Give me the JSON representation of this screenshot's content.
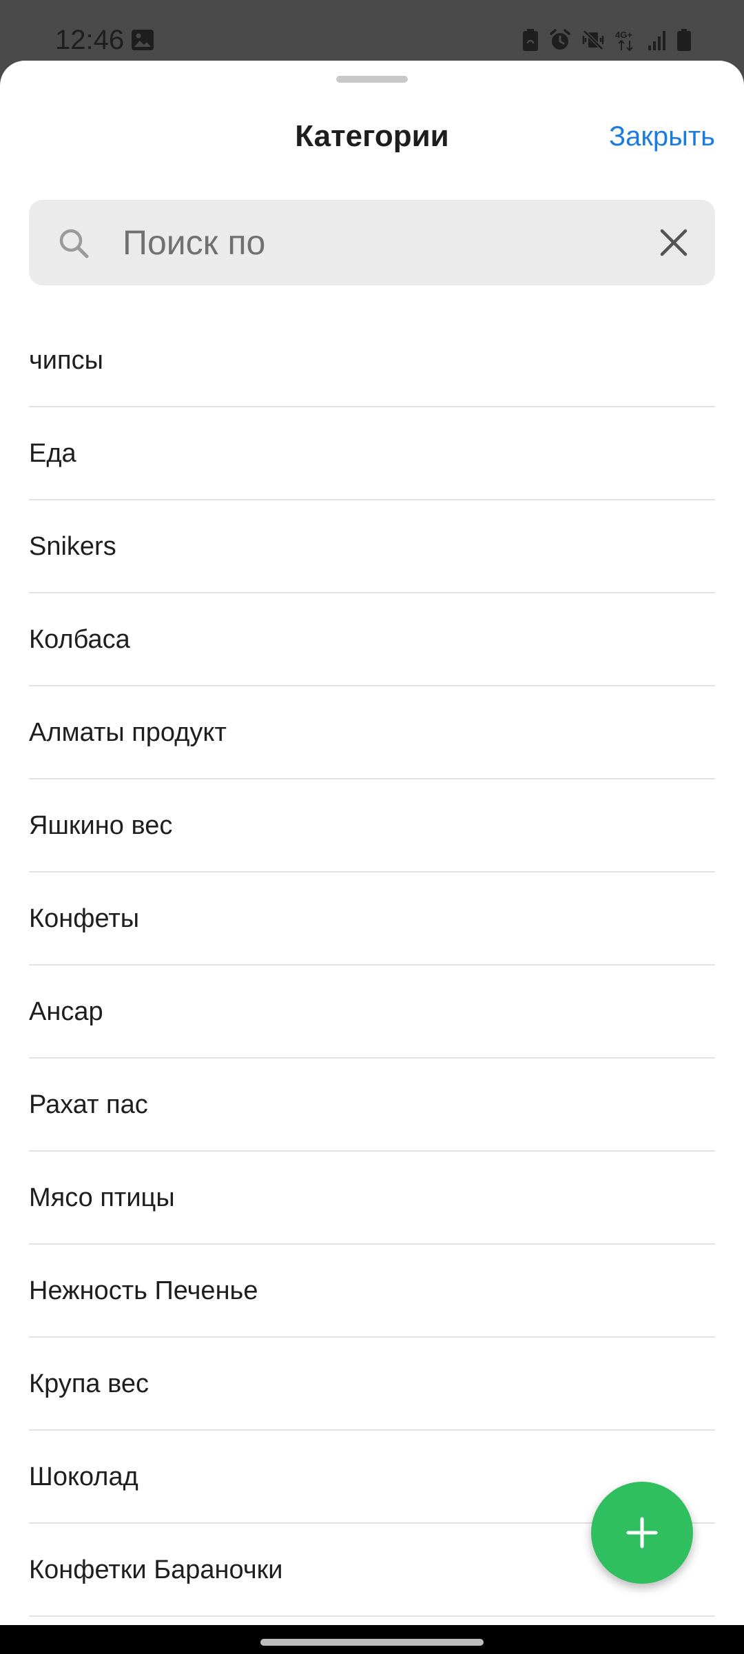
{
  "status_bar": {
    "time": "12:46",
    "left_icons": [
      "image-icon"
    ],
    "right_icons": [
      "battery-saver-icon",
      "alarm-icon",
      "vibrate-off-icon",
      "network-4g-icon",
      "signal-icon",
      "battery-icon"
    ],
    "network_label": "4G+"
  },
  "sheet": {
    "title": "Категории",
    "close_label": "Закрыть"
  },
  "search": {
    "placeholder": "Поиск по",
    "value": ""
  },
  "categories": [
    {
      "label": "чипсы"
    },
    {
      "label": "Еда"
    },
    {
      "label": "Snikers"
    },
    {
      "label": "Колбаса"
    },
    {
      "label": "Алматы продукт"
    },
    {
      "label": "Яшкино вес"
    },
    {
      "label": "Конфеты"
    },
    {
      "label": "Ансар"
    },
    {
      "label": "Рахат пас"
    },
    {
      "label": "Мясо птицы"
    },
    {
      "label": "Нежность Печенье"
    },
    {
      "label": "Крупа вес"
    },
    {
      "label": "Шоколад"
    },
    {
      "label": "Конфетки Бараночки"
    }
  ],
  "fab": {
    "icon": "plus-icon"
  },
  "colors": {
    "accent": "#1a7be0",
    "fab": "#2fbf5f",
    "search_bg": "#ebebeb"
  }
}
